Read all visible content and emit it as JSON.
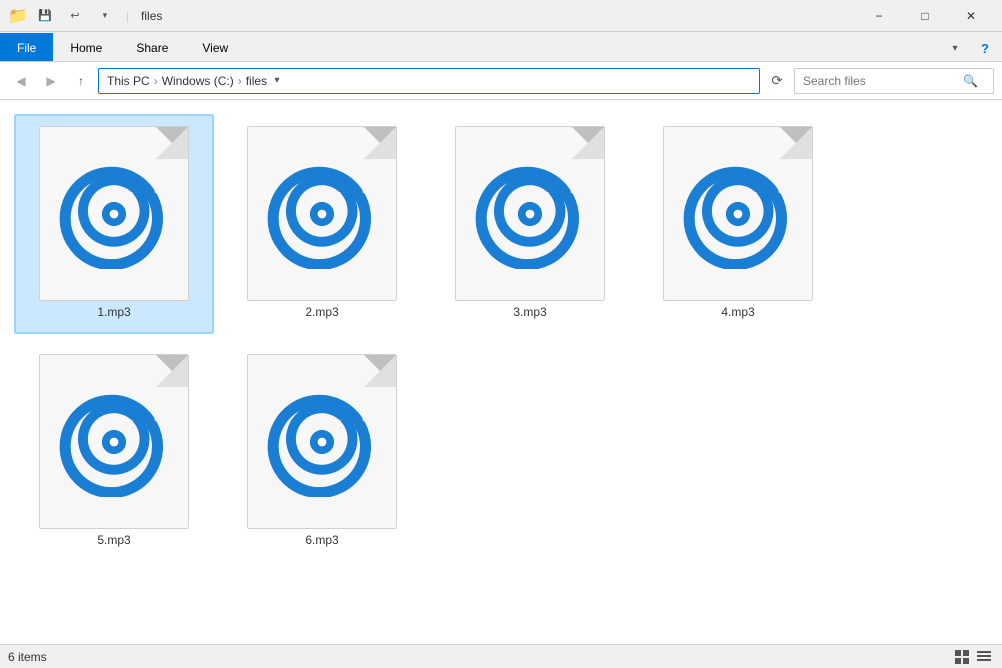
{
  "window": {
    "title": "files",
    "title_icon": "📁"
  },
  "titlebar": {
    "quick_access": [
      "save",
      "undo",
      "customize"
    ],
    "minimize_label": "−",
    "maximize_label": "□",
    "close_label": "✕"
  },
  "ribbon": {
    "tabs": [
      "File",
      "Home",
      "Share",
      "View"
    ],
    "active_tab": "File"
  },
  "addressbar": {
    "back_label": "◀",
    "forward_label": "▶",
    "up_label": "↑",
    "breadcrumb": [
      "This PC",
      "Windows (C:)",
      "files"
    ],
    "search_placeholder": "Search files",
    "search_label": "Search",
    "refresh_label": "⟳"
  },
  "files": [
    {
      "name": "1.mp3",
      "selected": true
    },
    {
      "name": "2.mp3",
      "selected": false
    },
    {
      "name": "3.mp3",
      "selected": false
    },
    {
      "name": "4.mp3",
      "selected": false
    },
    {
      "name": "5.mp3",
      "selected": false
    },
    {
      "name": "6.mp3",
      "selected": false
    }
  ],
  "statusbar": {
    "item_count": "6 items",
    "view_icons": [
      "grid-view",
      "list-view"
    ]
  }
}
